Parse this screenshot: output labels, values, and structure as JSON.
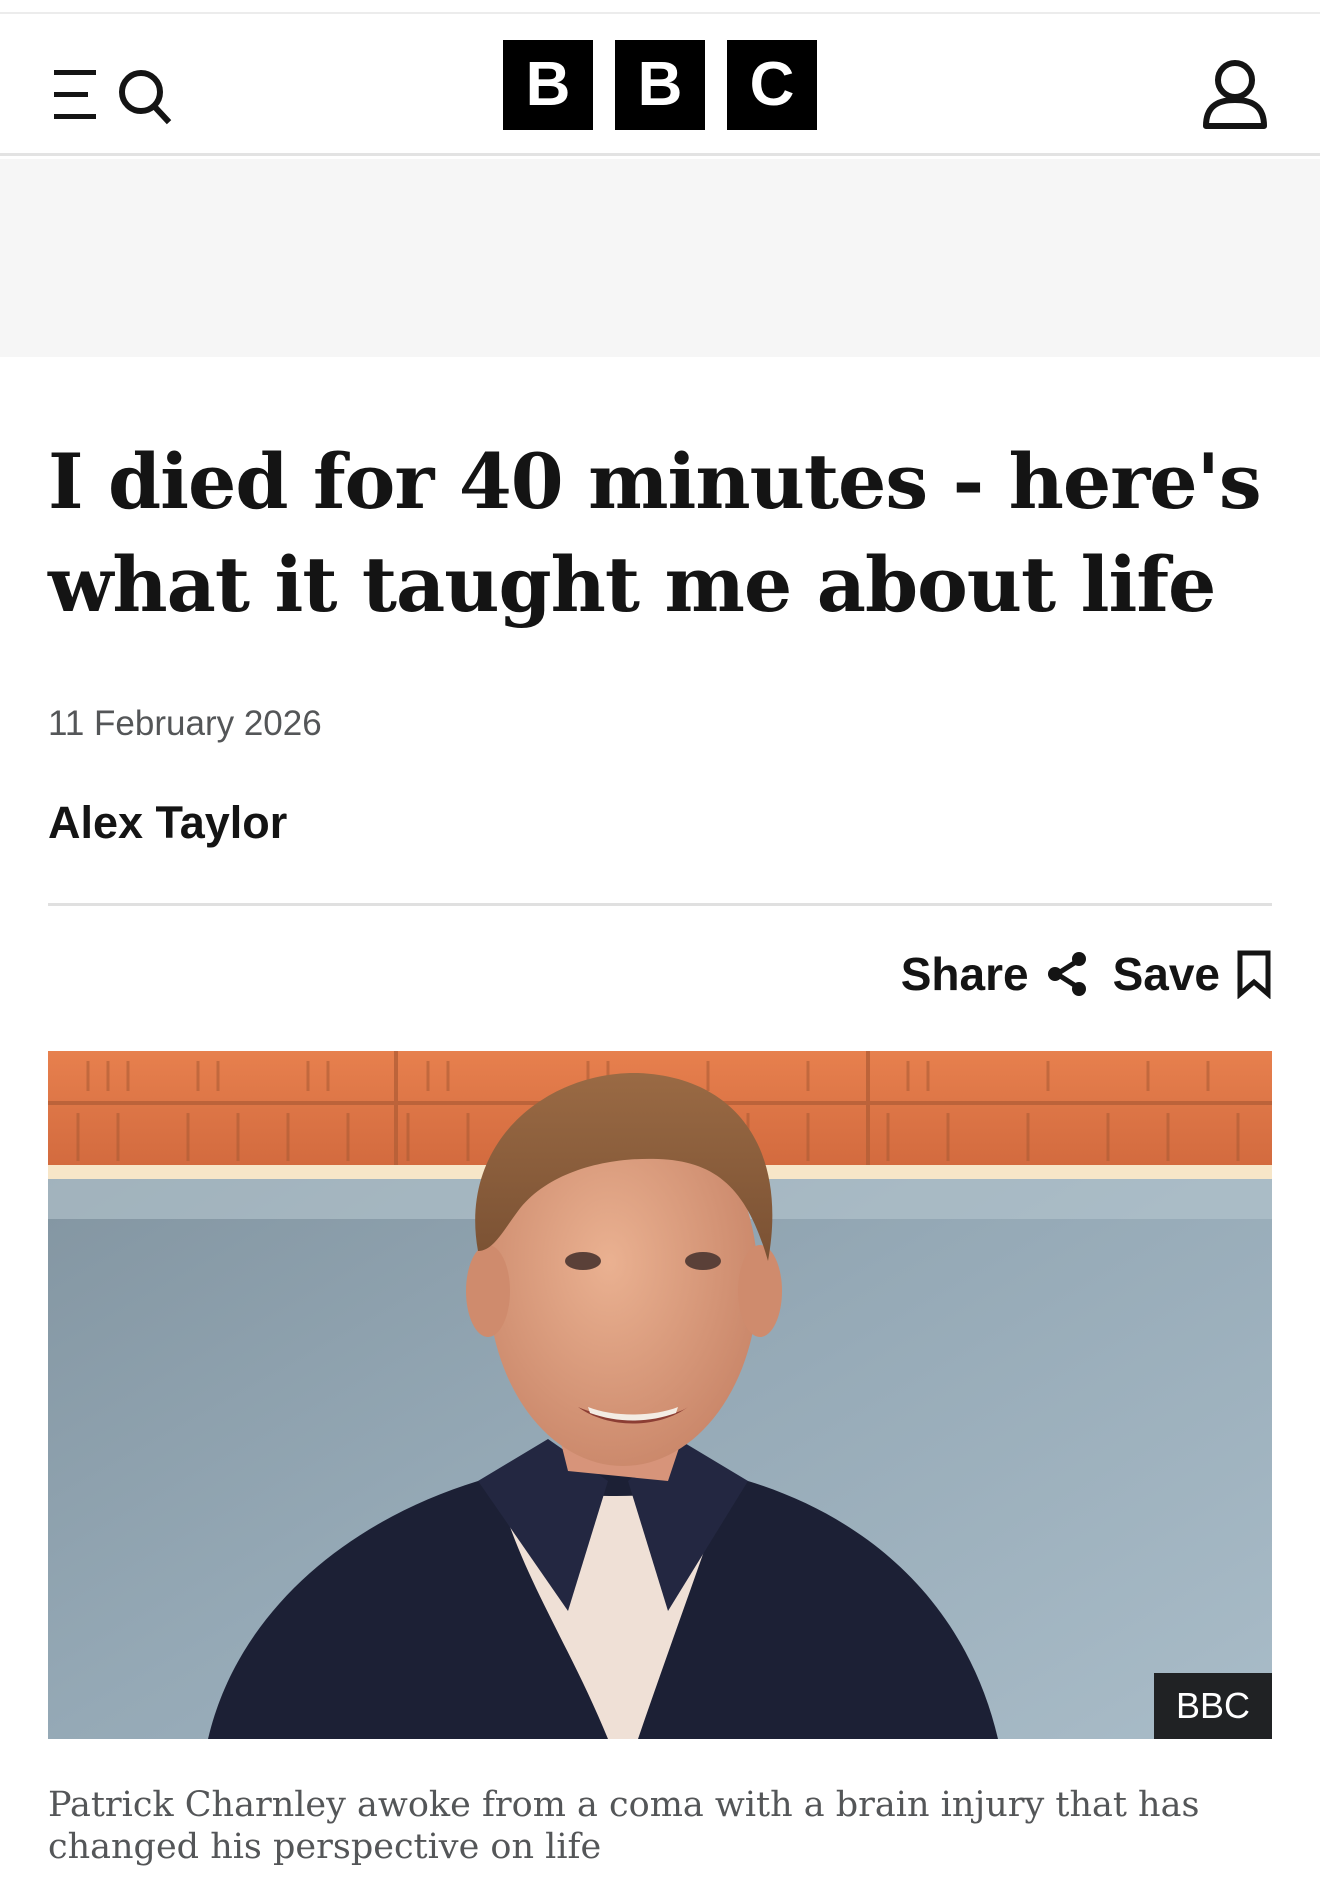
{
  "header": {
    "logo_letters": [
      "B",
      "B",
      "C"
    ],
    "menu_icon": "menu-icon",
    "search_icon": "search-icon",
    "account_icon": "account-icon"
  },
  "article": {
    "headline": "I died for 40 minutes - here's what it taught me about life",
    "date": "11 February 2026",
    "author": "Alex Taylor",
    "share_label": "Share",
    "save_label": "Save",
    "image_credit": "BBC",
    "caption": "Patrick Charnley awoke from a coma with a brain injury that has changed his perspective on life"
  },
  "colors": {
    "text": "#141414",
    "meta_text": "#545658",
    "ad_band": "#f6f6f6",
    "logo_block": "#000000"
  }
}
